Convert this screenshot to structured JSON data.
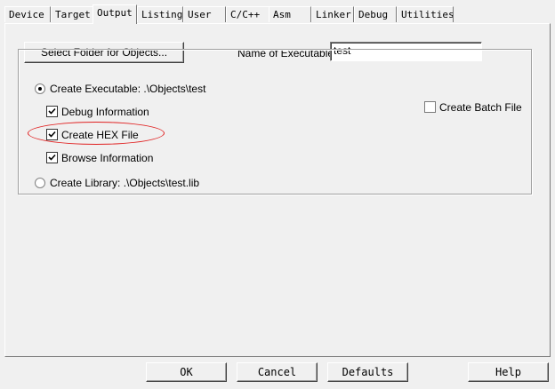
{
  "tabs": [
    {
      "label": "Device"
    },
    {
      "label": "Target"
    },
    {
      "label": "Output"
    },
    {
      "label": "Listing"
    },
    {
      "label": "User"
    },
    {
      "label": "C/C++"
    },
    {
      "label": "Asm"
    },
    {
      "label": "Linker"
    },
    {
      "label": "Debug"
    },
    {
      "label": "Utilities"
    }
  ],
  "active_tab": "Output",
  "output": {
    "select_folder_label": "Select Folder for Objects...",
    "name_of_executable_label": "Name of Executable:",
    "name_of_executable_value": "test",
    "create_executable_label": "Create Executable:  .\\Objects\\test",
    "debug_information_label": "Debug Information",
    "create_hex_label": "Create HEX File",
    "browse_information_label": "Browse Information",
    "create_library_label": "Create Library:  .\\Objects\\test.lib",
    "create_batch_file_label": "Create Batch File",
    "create_executable_selected": true,
    "debug_information_checked": true,
    "create_hex_checked": true,
    "browse_information_checked": true,
    "create_batch_file_checked": false
  },
  "buttons": {
    "ok": "OK",
    "cancel": "Cancel",
    "defaults": "Defaults",
    "help": "Help"
  },
  "colors": {
    "highlight_ellipse": "#e02020",
    "background": "#f0f0f0"
  }
}
